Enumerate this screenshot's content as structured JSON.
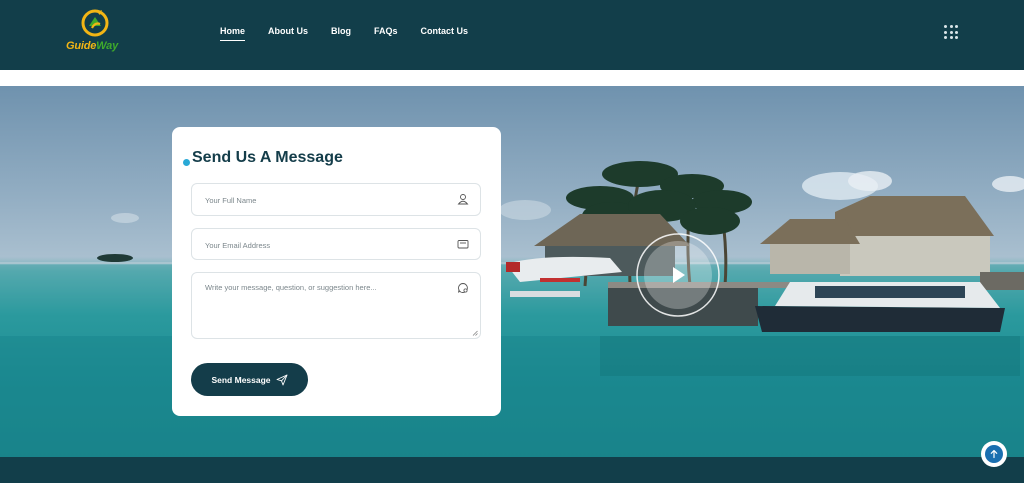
{
  "brand": {
    "logo_word1": "Guide",
    "logo_word2": "Way",
    "logo_icon": "compass-arrow-icon"
  },
  "nav": {
    "items": [
      {
        "label": "Home",
        "active": true
      },
      {
        "label": "About Us",
        "active": false
      },
      {
        "label": "Blog",
        "active": false
      },
      {
        "label": "FAQs",
        "active": false
      },
      {
        "label": "Contact Us",
        "active": false
      }
    ],
    "menu_icon": "grid-dots-icon"
  },
  "form": {
    "title": "Send Us A Message",
    "name_placeholder": "Your Full Name",
    "email_placeholder": "Your Email Address",
    "message_placeholder": "Write your message, question, or suggestion here...",
    "submit_label": "Send Message",
    "icons": {
      "name": "user-icon",
      "email": "envelope-icon",
      "message": "chat-bubble-icon",
      "submit": "paper-plane-icon"
    }
  },
  "hero": {
    "video_icon": "play-icon",
    "scene": "lagoon-overwater-villas-image"
  },
  "utility": {
    "back_to_top_icon": "arrow-up-icon"
  },
  "colors": {
    "header_bg": "#123e4a",
    "primary": "#143d4a",
    "accent_dot": "#29a9d6",
    "logo_gold": "#f2b515",
    "logo_green": "#3faa2b",
    "back_to_top": "#1a6fb0"
  }
}
